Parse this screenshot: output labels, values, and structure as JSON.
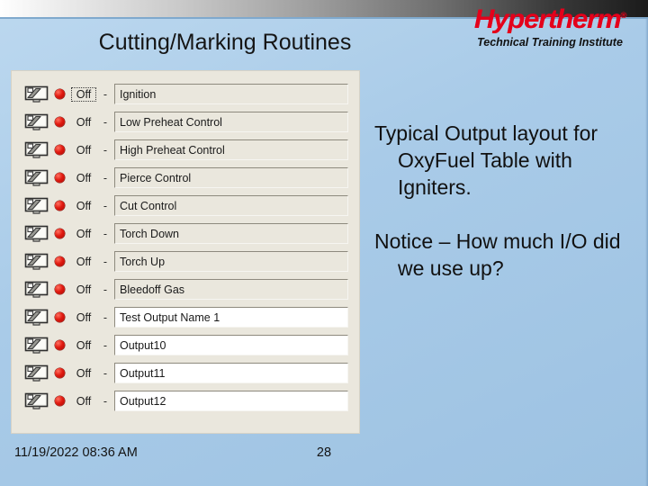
{
  "slide": {
    "title": "Cutting/Marking Routines",
    "background_color": "#a9cbe8",
    "accent_color": "#e4001b"
  },
  "logo": {
    "brand": "Hypertherm",
    "registered_mark": "®",
    "subtitle": "Technical Training Institute"
  },
  "output_panel": {
    "state_label": "Off",
    "separator": "-",
    "rows": [
      {
        "state": "Off",
        "separator": "-",
        "name": "Ignition",
        "focused": true,
        "field_white": false
      },
      {
        "state": "Off",
        "separator": "-",
        "name": "Low Preheat Control",
        "focused": false,
        "field_white": false
      },
      {
        "state": "Off",
        "separator": "-",
        "name": "High Preheat Control",
        "focused": false,
        "field_white": false
      },
      {
        "state": "Off",
        "separator": "-",
        "name": "Pierce Control",
        "focused": false,
        "field_white": false
      },
      {
        "state": "Off",
        "separator": "-",
        "name": "Cut Control",
        "focused": false,
        "field_white": false
      },
      {
        "state": "Off",
        "separator": "-",
        "name": "Torch Down",
        "focused": false,
        "field_white": false
      },
      {
        "state": "Off",
        "separator": "-",
        "name": "Torch Up",
        "focused": false,
        "field_white": false
      },
      {
        "state": "Off",
        "separator": "-",
        "name": "Bleedoff Gas",
        "focused": false,
        "field_white": false
      },
      {
        "state": "Off",
        "separator": "-",
        "name": "Test Output Name 1",
        "focused": false,
        "field_white": true
      },
      {
        "state": "Off",
        "separator": "-",
        "name": "Output10",
        "focused": false,
        "field_white": true
      },
      {
        "state": "Off",
        "separator": "-",
        "name": "Output11",
        "focused": false,
        "field_white": true
      },
      {
        "state": "Off",
        "separator": "-",
        "name": "Output12",
        "focused": false,
        "field_white": true
      }
    ]
  },
  "body": {
    "paragraph_1": "Typical Output layout for OxyFuel Table with Igniters.",
    "paragraph_2": "Notice – How much I/O did we use up?"
  },
  "footer": {
    "timestamp": "11/19/2022 08:36 AM",
    "page_number": "28"
  }
}
